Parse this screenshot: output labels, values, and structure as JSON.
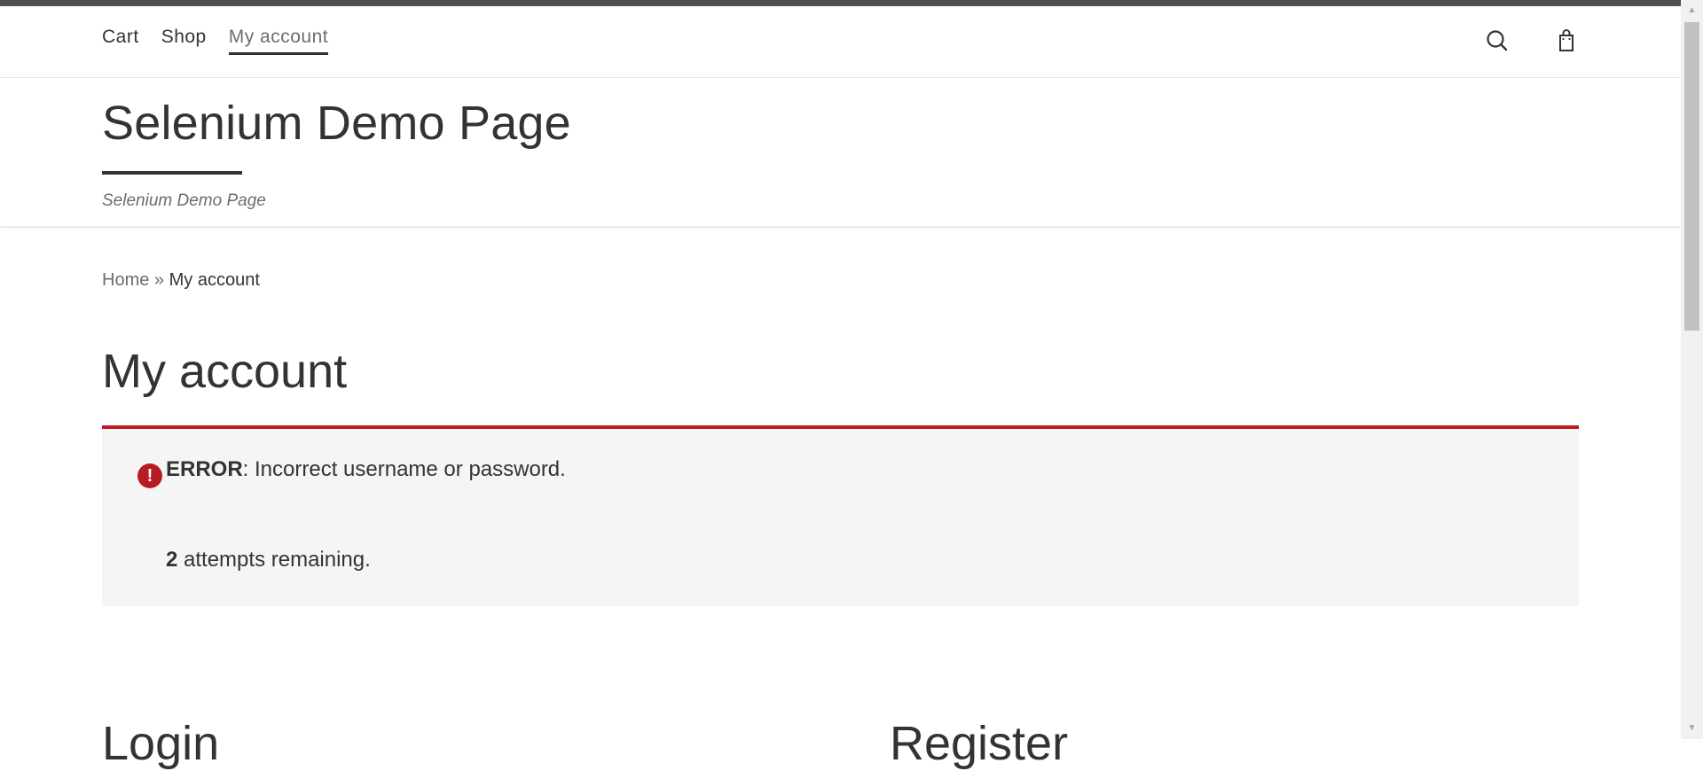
{
  "nav": {
    "items": [
      "Cart",
      "Shop",
      "My account"
    ]
  },
  "header_icons": [
    "search-icon",
    "shopping-bag-icon"
  ],
  "site": {
    "title": "Selenium Demo Page",
    "description": "Selenium Demo Page"
  },
  "breadcrumb": {
    "home": "Home",
    "separator": " » ",
    "current": "My account"
  },
  "page": {
    "title": "My account"
  },
  "error_notice": {
    "icon": "exclamation-circle-icon",
    "label": "ERROR",
    "message": ": Incorrect username or password.",
    "attempts_count": "2",
    "attempts_text": " attempts remaining."
  },
  "sections": {
    "login_heading": "Login",
    "register_heading": "Register"
  },
  "colors": {
    "error_accent": "#b81c23",
    "notice_background": "#f5f5f5",
    "text": "#333333"
  }
}
